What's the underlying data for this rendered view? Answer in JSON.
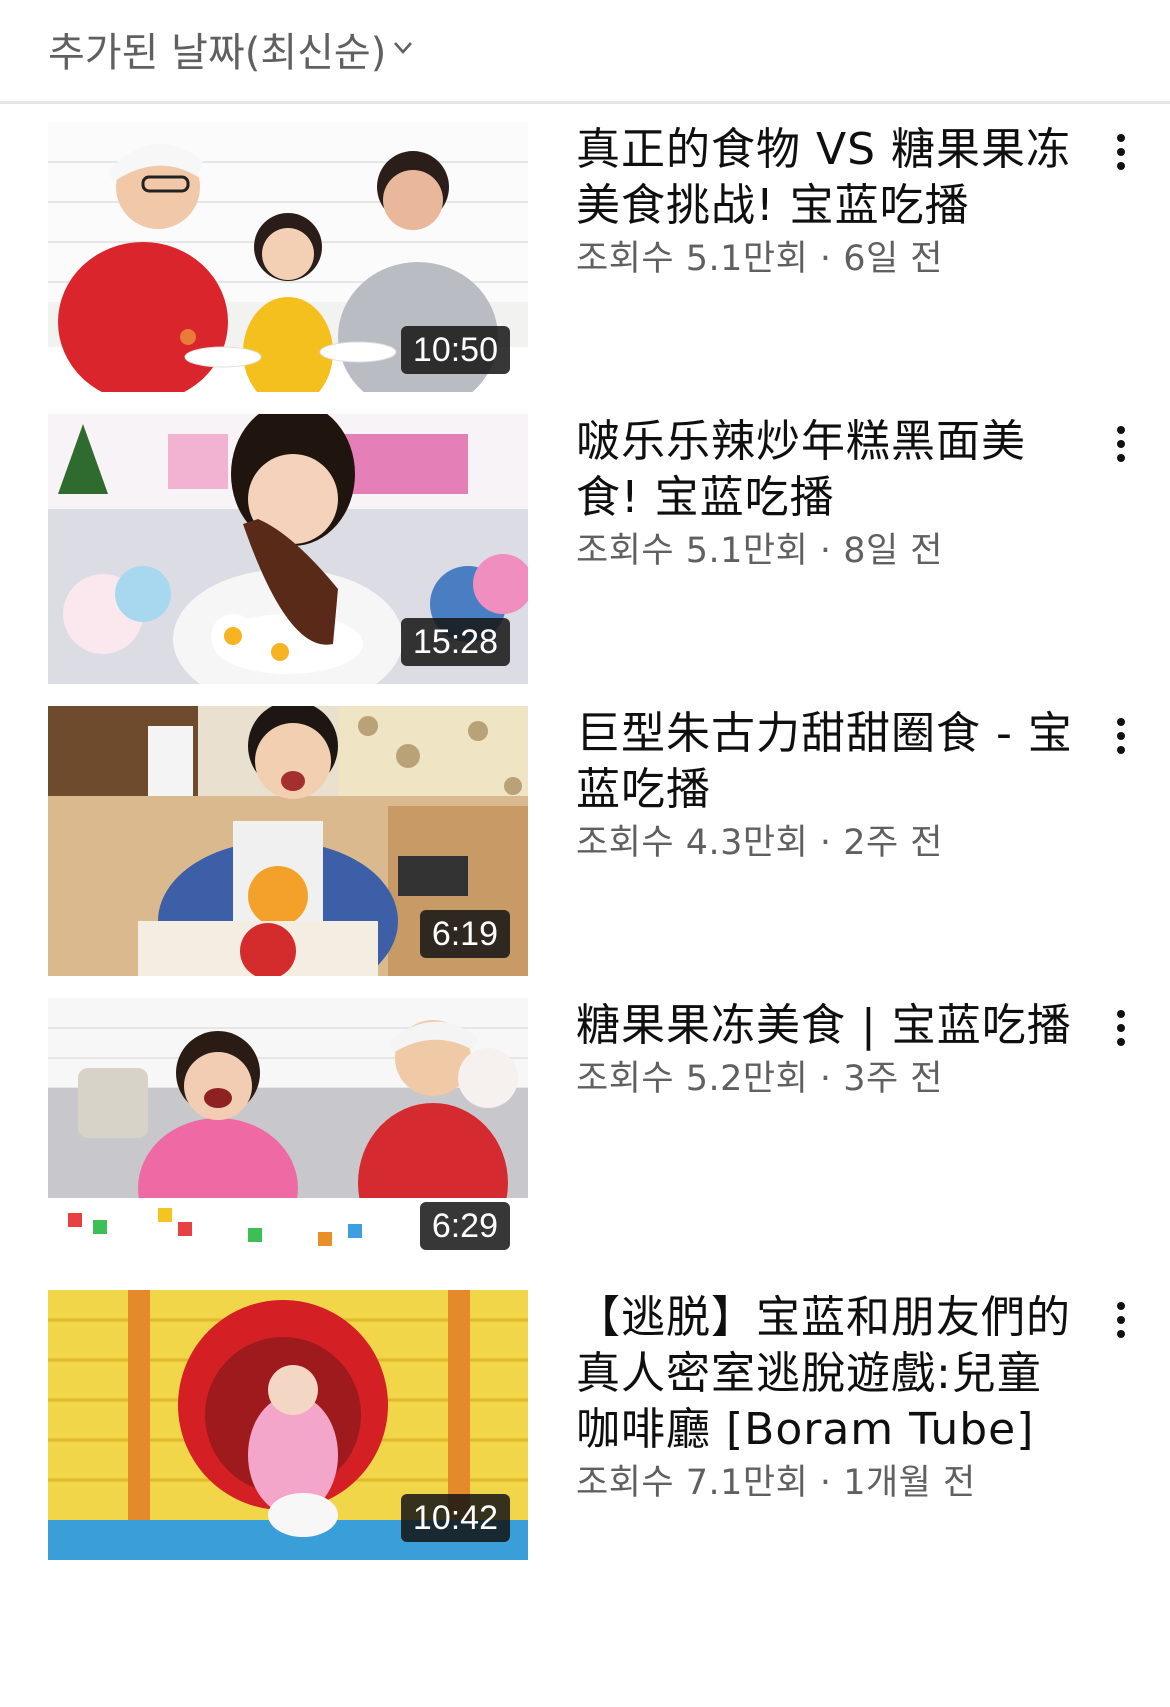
{
  "sort": {
    "label": "추가된 날짜(최신순)",
    "icon": "chevron-down-icon"
  },
  "videos": [
    {
      "title": "真正的食物 VS 糖果果冻美食挑战! 宝蓝吃播",
      "views": "조회수 5.1만회",
      "age": "6일 전",
      "duration": "10:50"
    },
    {
      "title": "啵乐乐辣炒年糕黑面美食! 宝蓝吃播",
      "views": "조회수 5.1만회",
      "age": "8일 전",
      "duration": "15:28"
    },
    {
      "title": "巨型朱古力甜甜圈食 - 宝蓝吃播",
      "views": "조회수 4.3만회",
      "age": "2주 전",
      "duration": "6:19"
    },
    {
      "title": "糖果果冻美食 | 宝蓝吃播",
      "views": "조회수 5.2만회",
      "age": "3주 전",
      "duration": "6:29"
    },
    {
      "title": "【逃脱】宝蓝和朋友們的真人密室逃脫遊戲:兒童咖啡廳 [Boram Tube]",
      "views": "조회수 7.1만회",
      "age": "1개월 전",
      "duration": "10:42"
    }
  ],
  "meta_separator": " · "
}
